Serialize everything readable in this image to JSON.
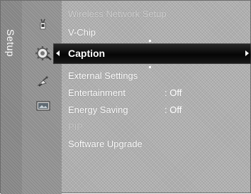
{
  "side_title": "Setup",
  "menu": {
    "items": [
      {
        "label": "Wireless Network Setup",
        "value": ""
      },
      {
        "label": "V-Chip",
        "value": ""
      },
      {
        "label": "Caption",
        "value": ""
      },
      {
        "label": "External Settings",
        "value": ""
      },
      {
        "label": "Entertainment",
        "value": ": Off"
      },
      {
        "label": "Energy Saving",
        "value": ": Off"
      },
      {
        "label": "PIP",
        "value": ""
      },
      {
        "label": "Software Upgrade",
        "value": ""
      }
    ],
    "selected_index": 2,
    "disabled_index": 6
  },
  "icons": [
    "antenna-icon",
    "gear-setup-icon",
    "satellite-icon",
    "input-screen-icon"
  ],
  "colors": {
    "background": "#b9b9b9",
    "highlight": "#000000",
    "text": "#ffffff"
  }
}
